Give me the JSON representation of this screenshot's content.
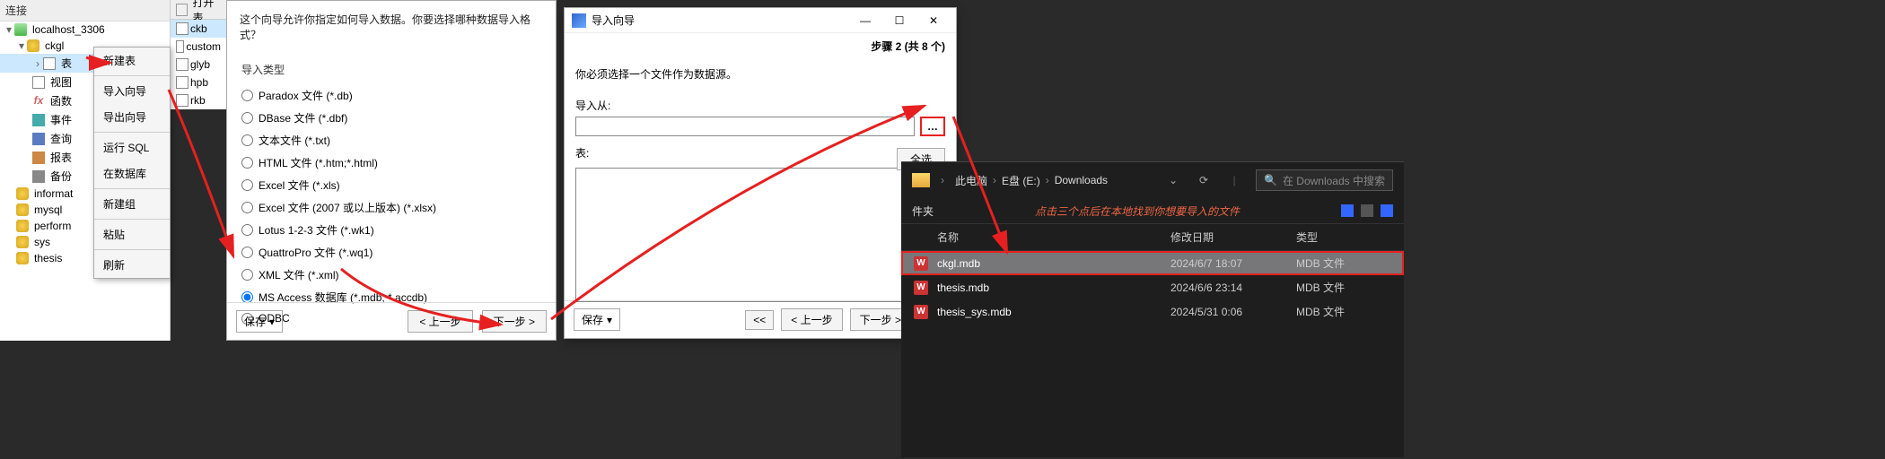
{
  "db_panel": {
    "title": "连接",
    "conn": "localhost_3306",
    "schema": "ckgl",
    "nodes": {
      "tables": "表",
      "views": "视图",
      "functions": "函数",
      "events": "事件",
      "queries": "查询",
      "reports": "报表",
      "backups": "备份"
    },
    "below": {
      "informat": "informat",
      "mysql": "mysql",
      "perform": "perform",
      "sys": "sys",
      "thesis": "thesis"
    }
  },
  "open_tab": "打开表",
  "tables_list": [
    "ckb",
    "custom",
    "glyb",
    "hpb",
    "rkb"
  ],
  "ctx_menu": [
    "新建表",
    "导入向导",
    "导出向导",
    "运行 SQL",
    "在数据库",
    "新建组",
    "粘贴",
    "刷新"
  ],
  "wz1": {
    "question": "这个向导允许你指定如何导入数据。你要选择哪种数据导入格式？",
    "group": "导入类型",
    "options": [
      "Paradox 文件 (*.db)",
      "DBase 文件 (*.dbf)",
      "文本文件 (*.txt)",
      "HTML 文件 (*.htm;*.html)",
      "Excel 文件 (*.xls)",
      "Excel 文件 (2007 或以上版本) (*.xlsx)",
      "Lotus 1-2-3 文件 (*.wk1)",
      "QuattroPro 文件 (*.wq1)",
      "XML 文件 (*.xml)",
      "MS Access 数据库 (*.mdb; *.accdb)",
      "ODBC"
    ],
    "selected": 9,
    "save": "保存",
    "prev": "< 上一步",
    "next": "下一步 >"
  },
  "wz2": {
    "title": "导入向导",
    "step": "步骤 2 (共 8 个)",
    "desc": "你必须选择一个文件作为数据源。",
    "from_label": "导入从:",
    "table_label": "表:",
    "browse": "…",
    "select_all": "全选",
    "save": "保存",
    "prev_first": "<<",
    "prev": "< 上一步",
    "next": "下一步 >",
    "next_last": ">>"
  },
  "explorer": {
    "crumbs": [
      "此电脑",
      "E盘 (E:)",
      "Downloads"
    ],
    "search_placeholder": "在 Downloads 中搜索",
    "left_label": "件夹",
    "annotation": "点击三个点后在本地找到你想要导入的文件",
    "cols": {
      "name": "名称",
      "date": "修改日期",
      "type": "类型"
    },
    "files": [
      {
        "name": "ckgl.mdb",
        "date": "2024/6/7 18:07",
        "type": "MDB 文件",
        "selected": true,
        "boxed": true
      },
      {
        "name": "thesis.mdb",
        "date": "2024/6/6 23:14",
        "type": "MDB 文件"
      },
      {
        "name": "thesis_sys.mdb",
        "date": "2024/5/31 0:06",
        "type": "MDB 文件"
      }
    ]
  }
}
